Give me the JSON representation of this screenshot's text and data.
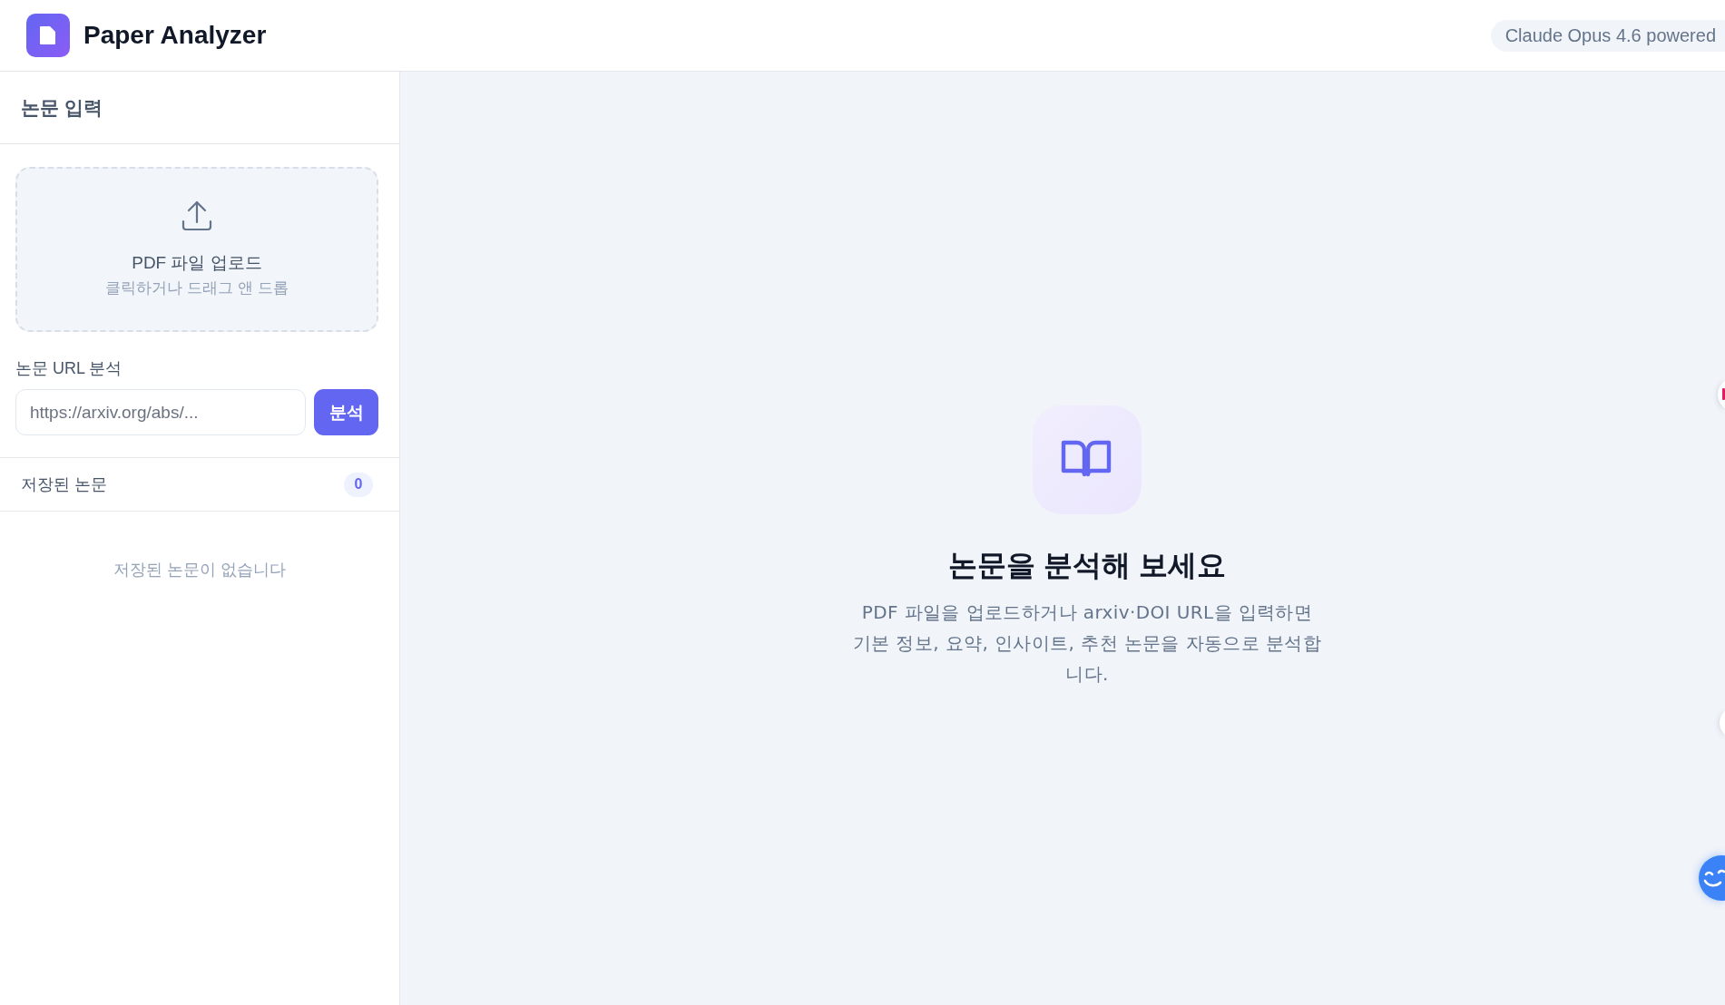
{
  "header": {
    "title": "Paper Analyzer",
    "badge": "Claude Opus 4.6 powered"
  },
  "sidebar": {
    "section_title": "논문 입력",
    "upload": {
      "title": "PDF 파일 업로드",
      "hint": "클릭하거나 드래그 앤 드롭"
    },
    "url": {
      "label": "논문 URL 분석",
      "placeholder": "https://arxiv.org/abs/...",
      "button": "분석"
    },
    "saved": {
      "title": "저장된 논문",
      "count": "0",
      "empty_message": "저장된 논문이 없습니다"
    }
  },
  "main": {
    "empty_state": {
      "title": "논문을 분석해 보세요",
      "description": "PDF 파일을 업로드하거나 arxiv·DOI URL을 입력하면 기본 정보, 요약, 인사이트, 추천 논문을 자동으로 분석합니다."
    }
  }
}
